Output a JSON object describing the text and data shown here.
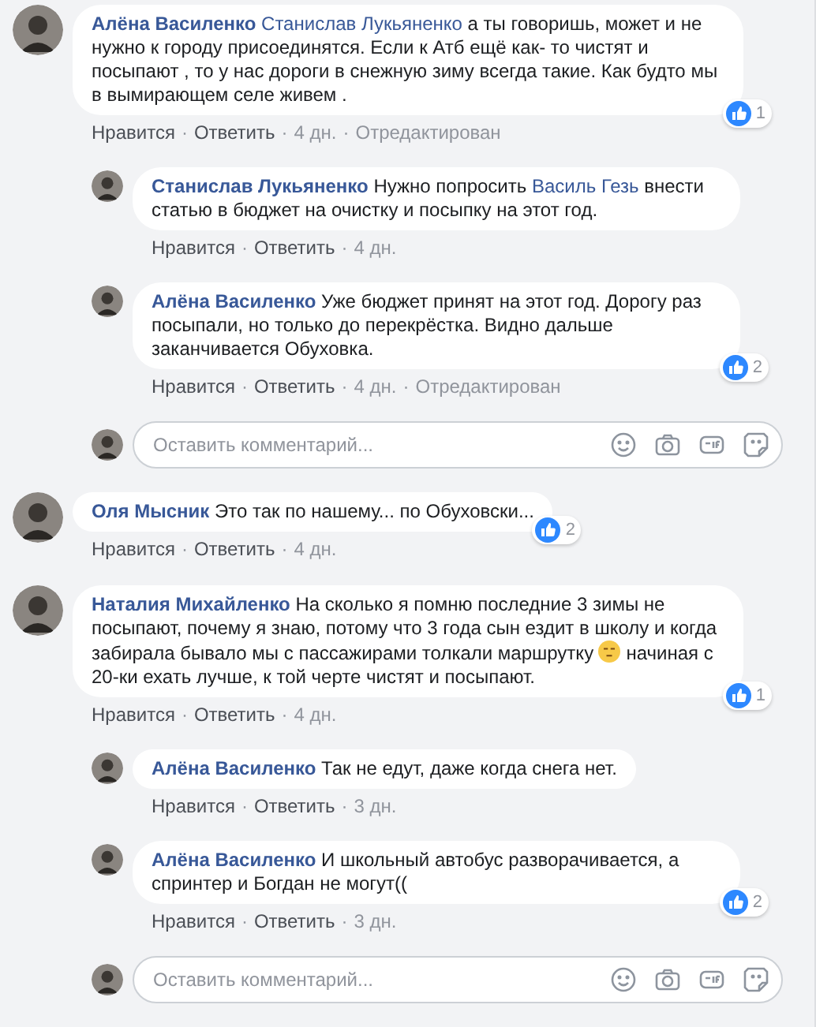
{
  "meta_separator": "·",
  "threads": [
    {
      "comment": {
        "author": "Алёна Василенко",
        "segments": [
          {
            "kind": "mention",
            "text": "Станислав Лукьяненко"
          },
          {
            "kind": "text",
            "text": " а ты говоришь, может и не нужно к городу присоединятся. Если к Атб ещё как- то чистят и посыпают , то у нас дороги в снежную зиму всегда такие. Как будто мы в вымирающем селе живем ."
          }
        ],
        "reactions": "1",
        "actions": [
          "Нравится",
          "Ответить"
        ],
        "time": "4 дн.",
        "edited": "Отредактирован"
      },
      "replies": [
        {
          "author": "Станислав Лукьяненко",
          "segments": [
            {
              "kind": "text",
              "text": "Нужно попросить "
            },
            {
              "kind": "mention",
              "text": "Василь Гезь"
            },
            {
              "kind": "text",
              "text": " внести статью в бюджет на очистку и посыпку на этот год."
            }
          ],
          "actions": [
            "Нравится",
            "Ответить"
          ],
          "time": "4 дн."
        },
        {
          "author": "Алёна Василенко",
          "segments": [
            {
              "kind": "text",
              "text": "Уже бюджет принят на этот год. Дорогу раз посыпали, но только до перекрёстка. Видно дальше заканчивается Обуховка."
            }
          ],
          "reactions": "2",
          "actions": [
            "Нравится",
            "Ответить"
          ],
          "time": "4 дн.",
          "edited": "Отредактирован"
        }
      ],
      "composer": {
        "placeholder": "Оставить комментарий..."
      }
    },
    {
      "comment": {
        "author": "Оля Мысник",
        "segments": [
          {
            "kind": "text",
            "text": "Это так по нашему... по Обуховски..."
          }
        ],
        "reactions": "2",
        "actions": [
          "Нравится",
          "Ответить"
        ],
        "time": "4 дн."
      }
    },
    {
      "comment": {
        "author": "Наталия Михайленко",
        "segments": [
          {
            "kind": "text",
            "text": "На сколько я помню последние 3 зимы не посыпают, почему я знаю, потому что 3 года сын ездит в школу и когда забирала бывало мы с пассажирами толкали маршрутку "
          },
          {
            "kind": "emoji"
          },
          {
            "kind": "text",
            "text": " начиная с 20-ки ехать лучше, к той черте чистят и посыпают."
          }
        ],
        "reactions": "1",
        "actions": [
          "Нравится",
          "Ответить"
        ],
        "time": "4 дн."
      },
      "replies": [
        {
          "author": "Алёна Василенко",
          "segments": [
            {
              "kind": "text",
              "text": "Так не едут, даже когда снега нет."
            }
          ],
          "actions": [
            "Нравится",
            "Ответить"
          ],
          "time": "3 дн."
        },
        {
          "author": "Алёна Василенко",
          "segments": [
            {
              "kind": "text",
              "text": "И школьный автобус разворачивается, а спринтер и Богдан не могут(("
            }
          ],
          "reactions": "2",
          "actions": [
            "Нравится",
            "Ответить"
          ],
          "time": "3 дн."
        }
      ],
      "composer": {
        "placeholder": "Оставить комментарий..."
      }
    }
  ]
}
